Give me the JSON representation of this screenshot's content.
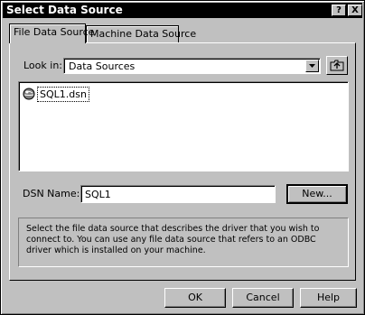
{
  "window": {
    "title": "Select Data Source",
    "help_btn": "?",
    "close_btn": "X"
  },
  "tabs": [
    {
      "label": "File Data Source"
    },
    {
      "label": "Machine Data Source"
    }
  ],
  "look_in": {
    "label": "Look in:",
    "value": "Data Sources"
  },
  "files": [
    {
      "name": "SQL1.dsn",
      "icon": "globe-dsn-icon"
    }
  ],
  "dsn": {
    "label": "DSN Name:",
    "value": "SQL1",
    "new_button": "New..."
  },
  "description": "Select the file data source that describes the driver that you wish to connect to. You can use any file data source that refers to an ODBC driver which is installed on your machine.",
  "buttons": {
    "ok": "OK",
    "cancel": "Cancel",
    "help": "Help"
  }
}
